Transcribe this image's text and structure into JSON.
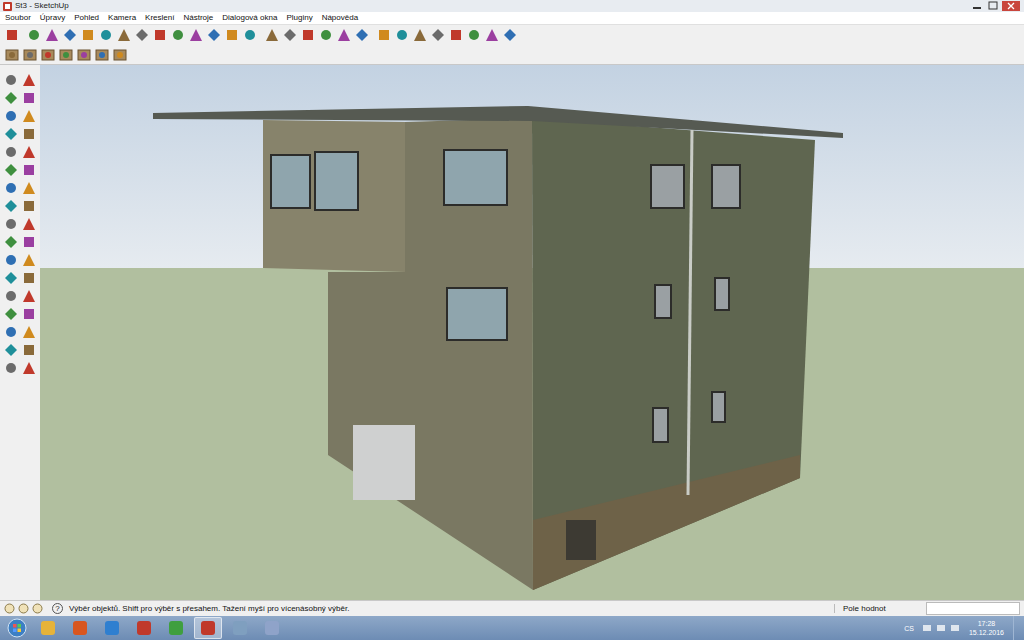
{
  "window": {
    "title": "St3 - SketchUp"
  },
  "menu": [
    "Soubor",
    "Úpravy",
    "Pohled",
    "Kamera",
    "Kreslení",
    "Nástroje",
    "Dialogová okna",
    "Pluginy",
    "Nápověda"
  ],
  "status_bar": {
    "help": "?",
    "text": "Výběr objektů. Shift pro výběr s přesahem. Tažení myší pro vícenásobný výběr.",
    "measurements_label": "Pole hodnot"
  },
  "taskbar": {
    "language": "CS",
    "time": "17:28",
    "date": "15.12.2016"
  }
}
